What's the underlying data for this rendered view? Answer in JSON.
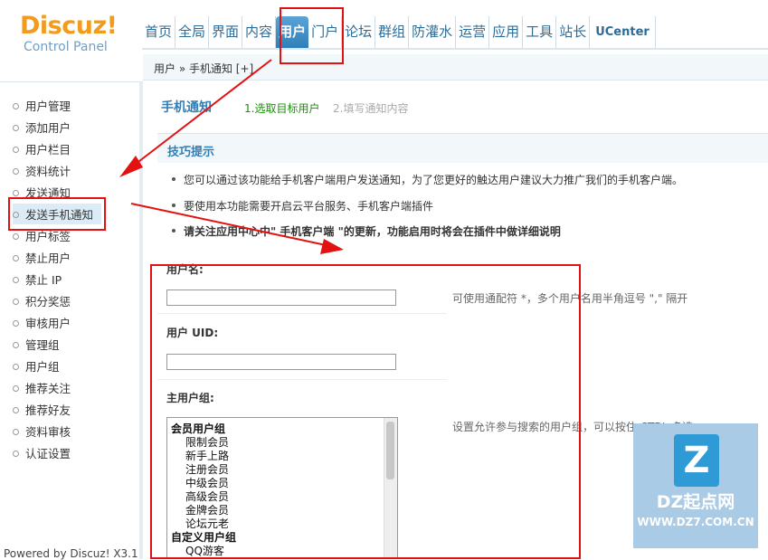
{
  "header": {
    "brand": "Discuz!",
    "brand_sub": "Control Panel",
    "nav": [
      "首页",
      "全局",
      "界面",
      "内容",
      "用户",
      "门户",
      "论坛",
      "群组",
      "防灌水",
      "运营",
      "应用",
      "工具",
      "站长",
      "UCenter"
    ],
    "active_nav": "用户"
  },
  "breadcrumb": {
    "text": "用户 » 手机通知 [+]"
  },
  "sidebar": {
    "items": [
      "用户管理",
      "添加用户",
      "用户栏目",
      "资料统计",
      "发送通知",
      "发送手机通知",
      "用户标签",
      "禁止用户",
      "禁止 IP",
      "积分奖惩",
      "审核用户",
      "管理组",
      "用户组",
      "推荐关注",
      "推荐好友",
      "资料审核",
      "认证设置"
    ],
    "active": "发送手机通知",
    "powered": "Powered by Discuz! X3.1"
  },
  "main": {
    "title": "手机通知",
    "step1": "1.选取目标用户",
    "step2": "2.填写通知内容",
    "tips_title": "技巧提示",
    "tips": [
      "您可以通过该功能给手机客户端用户发送通知，为了您更好的触达用户建议大力推广我们的手机客户端。",
      "要使用本功能需要开启云平台服务、手机客户端插件",
      "请关注应用中心中\" 手机客户端 \"的更新，功能启用时将会在插件中做详细说明"
    ],
    "fields": {
      "username_label": "用户名:",
      "username_hint": "可使用通配符 *，多个用户名用半角逗号 \",\" 隔开",
      "uid_label": "用户 UID:",
      "group_label": "主用户组:",
      "group_hint": "设置允许参与搜索的用户组，可以按住 CTRL 多选"
    },
    "group_options": [
      {
        "label": "会员用户组",
        "type": "grp"
      },
      {
        "label": "限制会员",
        "type": "sub"
      },
      {
        "label": "新手上路",
        "type": "sub"
      },
      {
        "label": "注册会员",
        "type": "sub"
      },
      {
        "label": "中级会员",
        "type": "sub"
      },
      {
        "label": "高级会员",
        "type": "sub"
      },
      {
        "label": "金牌会员",
        "type": "sub"
      },
      {
        "label": "论坛元老",
        "type": "sub"
      },
      {
        "label": "自定义用户组",
        "type": "grp"
      },
      {
        "label": "QQ游客",
        "type": "sub"
      }
    ]
  },
  "watermark": {
    "logo": "Z",
    "name": "DZ起点网",
    "url": "WWW.DZ7.COM.CN"
  },
  "colors": {
    "accent": "#2f7fb8",
    "annotation": "#e31212",
    "brand": "#f39b1c"
  }
}
